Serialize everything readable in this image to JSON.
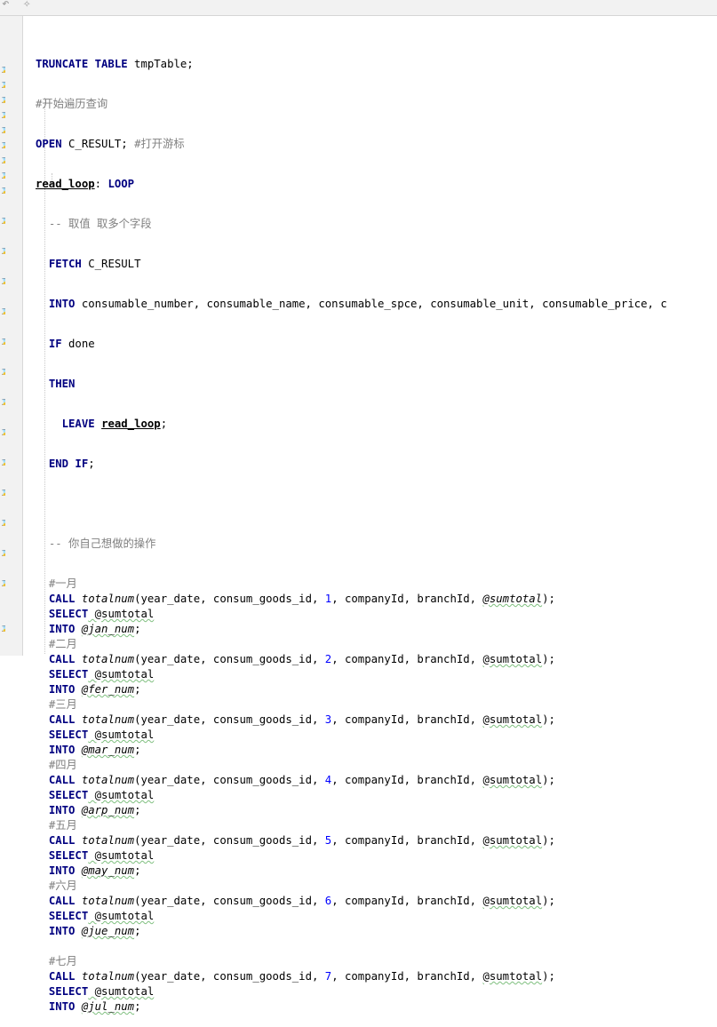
{
  "toolbar": {
    "icons": [
      "undo-icon",
      "magic-icon"
    ]
  },
  "code": {
    "truncate_kw": "TRUNCATE TABLE",
    "truncate_rest": " tmpTable;",
    "comment_start": "#开始遍历查询",
    "open_kw": "OPEN",
    "open_rest": " C_RESULT; ",
    "open_comment": "#打开游标",
    "loop_label": "read_loop",
    "loop_colon": ": ",
    "loop_kw": "LOOP",
    "comment_fetch": "-- 取值 取多个字段",
    "fetch_kw": "FETCH",
    "fetch_rest": " C_RESULT",
    "into_kw": "INTO",
    "into_rest": " consumable_number, consumable_name, consumable_spce, consumable_unit, consumable_price, c",
    "if_kw": "IF",
    "if_rest": " done",
    "then_kw": "THEN",
    "leave_kw": "LEAVE",
    "leave_label": "read_loop",
    "leave_end": ";",
    "endif_kw": "END IF",
    "endif_end": ";",
    "comment_ops": "-- 你自己想做的操作",
    "call_kw": "CALL",
    "fn_name": "totalnum",
    "call_prefix": "(year_date, consum_goods_id, ",
    "call_suffix": ", companyId, branchId, ",
    "call_var": "@sumtotal",
    "call_end": ");",
    "select_kw": "SELECT",
    "select_var": " @sumtotal",
    "months": [
      {
        "comment": "#一月",
        "num": "1",
        "var": "@jan_num"
      },
      {
        "comment": "#二月",
        "num": "2",
        "var": "@fer_num"
      },
      {
        "comment": "#三月",
        "num": "3",
        "var": "@mar_num"
      },
      {
        "comment": "#四月",
        "num": "4",
        "var": "@arp_num"
      },
      {
        "comment": "#五月",
        "num": "5",
        "var": "@may_num"
      },
      {
        "comment": "#六月",
        "num": "6",
        "var": "@jue_num"
      },
      {
        "comment": "#七月",
        "num": "7",
        "var": "@jul_num"
      }
    ]
  }
}
